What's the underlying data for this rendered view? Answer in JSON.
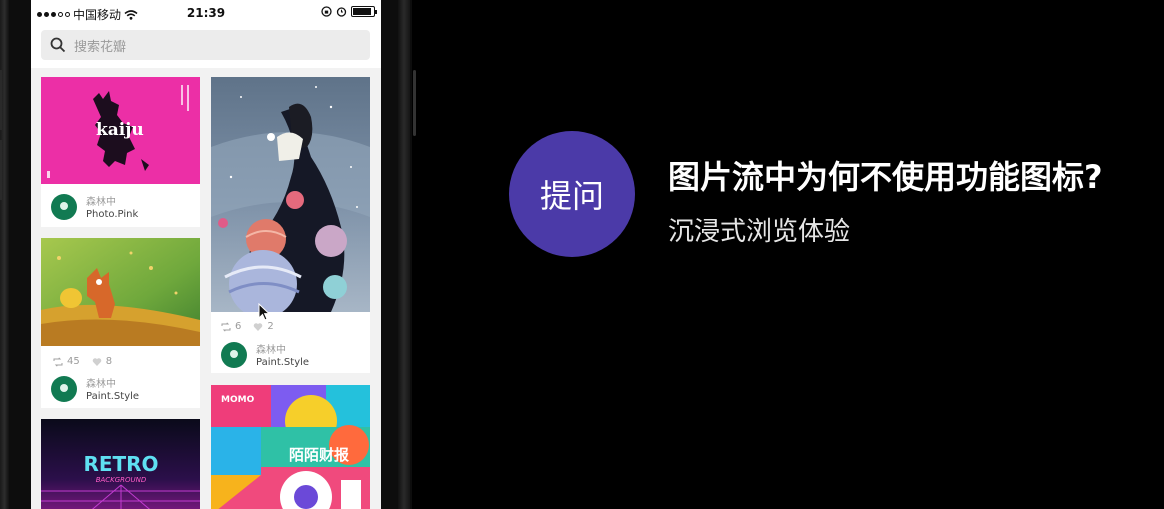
{
  "status_bar": {
    "carrier": "中国移动",
    "time": "21:39",
    "battery_level": 0.9
  },
  "search": {
    "placeholder": "搜索花瓣",
    "icon": "search-icon"
  },
  "feed": {
    "cards": [
      {
        "image": "kaiju-pink-poster",
        "image_text": "kaiju",
        "author": "森林中",
        "board": "Photo.Pink"
      },
      {
        "image": "fox-forest-illustration",
        "reposts": "45",
        "likes": "8",
        "author": "森林中",
        "board": "Paint.Style"
      },
      {
        "image": "retro-background",
        "image_text": "RETRO",
        "image_subtext": "BACKGROUND"
      },
      {
        "image": "girl-planets-illustration",
        "reposts": "6",
        "likes": "2",
        "author": "森林中",
        "board": "Paint.Style"
      },
      {
        "image": "momo-annual-report",
        "image_brand": "MOMO",
        "image_text": "陌陌财报"
      }
    ]
  },
  "qa": {
    "badge": "提问",
    "title": "图片流中为何不使用功能图标?",
    "subtitle": "沉浸式浏览体验"
  },
  "colors": {
    "badge_bg": "#4b3aa8",
    "avatar": "#117a52",
    "background": "#000000"
  }
}
